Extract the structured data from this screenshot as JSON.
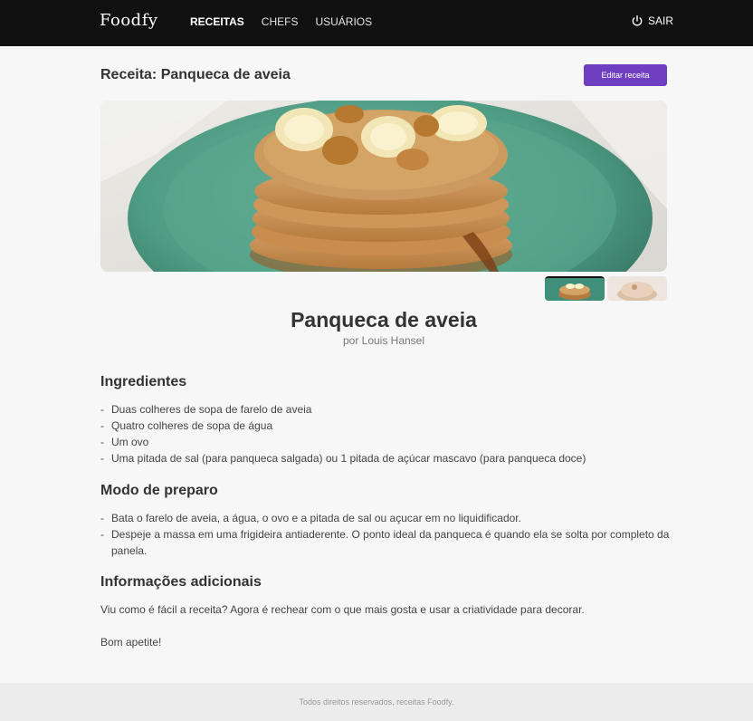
{
  "app": {
    "logo": "Foodfy"
  },
  "nav": [
    {
      "label": "RECEITAS",
      "active": true
    },
    {
      "label": "CHEFS",
      "active": false
    },
    {
      "label": "USUÁRIOS",
      "active": false
    }
  ],
  "logout": {
    "label": "SAIR",
    "icon": "power-icon"
  },
  "page": {
    "title": "Receita: Panqueca de aveia",
    "edit_label": "Editar receita"
  },
  "gallery": {
    "thumbnail_count": 2,
    "selected_index": 0
  },
  "recipe": {
    "title": "Panqueca de aveia",
    "author": "por Louis Hansel",
    "ingredients_title": "Ingredientes",
    "ingredients": [
      "Duas colheres de sopa de farelo de aveia",
      "Quatro colheres de sopa de água",
      "Um ovo",
      "Uma pitada de sal (para panqueca salgada) ou 1 pitada de açúcar mascavo (para panqueca doce)"
    ],
    "preparation_title": "Modo de preparo",
    "preparation": [
      "Bata o farelo de aveia, a água, o ovo e a pitada de sal ou açucar em no liquidificador.",
      "Despeje a massa em uma frigideira antiaderente. O ponto ideal da panqueca é quando ela se solta por completo da panela."
    ],
    "info_title": "Informações adicionais",
    "info": [
      "Viu como é fácil a receita? Agora é rechear com o que mais gosta e usar a criatividade para decorar.",
      "Bom apetite!"
    ]
  },
  "footer": {
    "text": "Todos direitos reservados, receitas Foodfy."
  },
  "colors": {
    "topbar": "#111111",
    "accent": "#6f3fc2",
    "footer_bg": "#ececec"
  }
}
